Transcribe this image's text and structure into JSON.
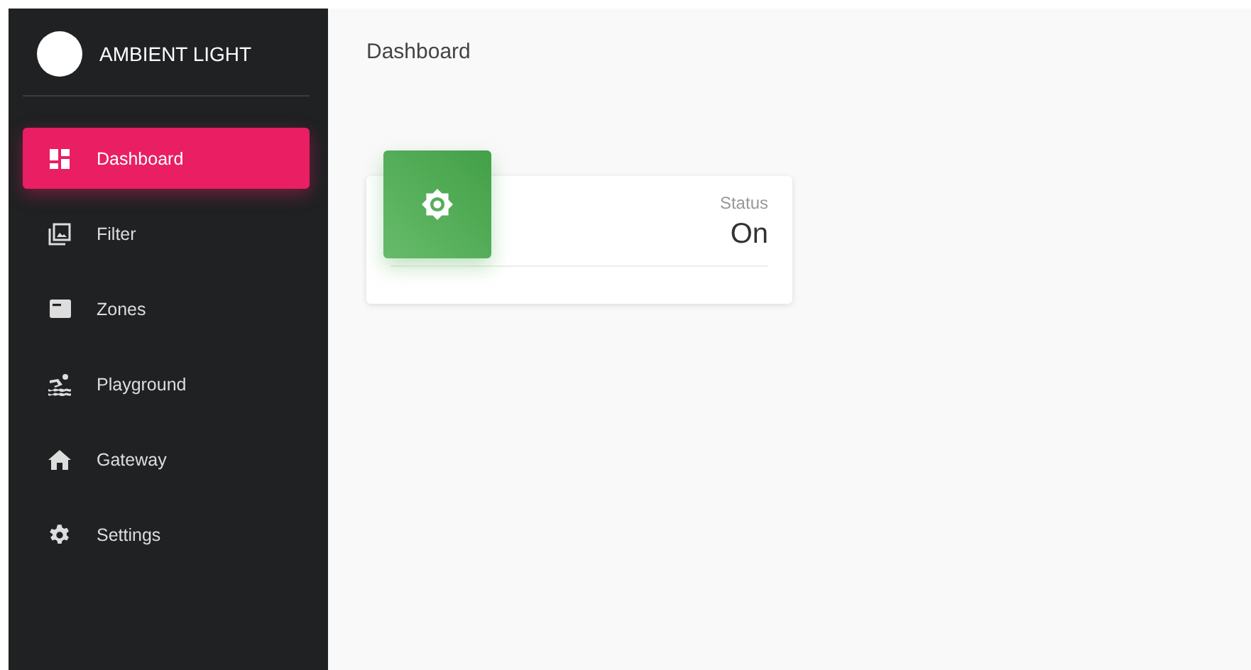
{
  "sidebar": {
    "title": "AMBIENT LIGHT",
    "items": [
      {
        "label": "Dashboard",
        "selected": true
      },
      {
        "label": "Filter",
        "selected": false
      },
      {
        "label": "Zones",
        "selected": false
      },
      {
        "label": "Playground",
        "selected": false
      },
      {
        "label": "Gateway",
        "selected": false
      },
      {
        "label": "Settings",
        "selected": false
      }
    ]
  },
  "page_title": "Dashboard",
  "cards": [
    {
      "label": "Status",
      "value": "On"
    }
  ]
}
